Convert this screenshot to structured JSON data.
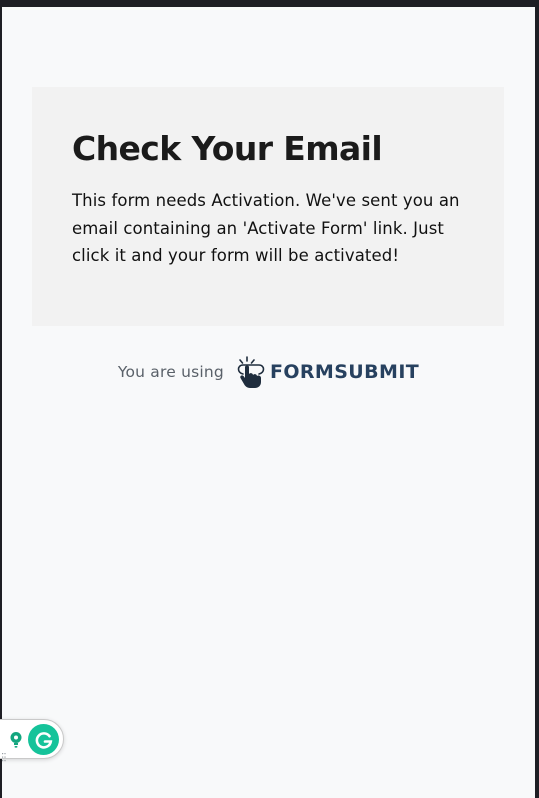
{
  "card": {
    "title": "Check Your Email",
    "message": "This form needs Activation. We've sent you an email containing an 'Activate Form' link. Just click it and your form will be activated!"
  },
  "footer": {
    "prefix": "You are using",
    "brand_name": "FORMSUBMIT",
    "brand_icon": "pointer-hand-icon"
  },
  "grammarly": {
    "icons": [
      "lightbulb-icon",
      "grammarly-g-icon",
      "drag-grip-icon"
    ]
  },
  "colors": {
    "page_bg": "#f8f9fa",
    "card_bg": "#f2f2f2",
    "brand": "#27415f",
    "grammarly": "#15c39a"
  }
}
